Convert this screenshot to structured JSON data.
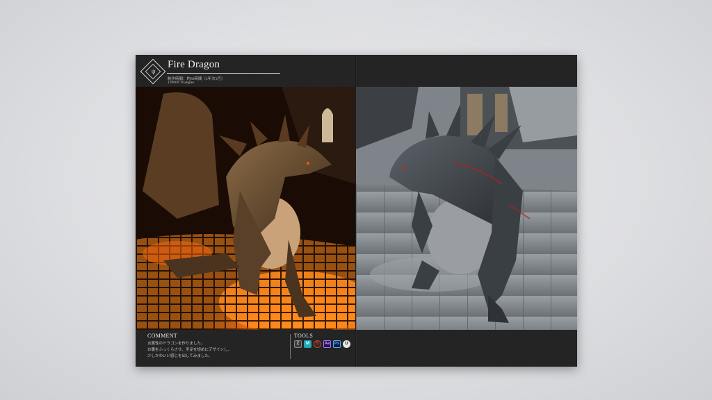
{
  "header": {
    "title": "Fire Dragon",
    "logo_glyph": "ψ",
    "meta_line_1": "制作時間：約80時間（2年次3月）",
    "meta_line_2": "139000 Triangles"
  },
  "images": {
    "left": {
      "icon": "fire-dragon-render"
    },
    "right": {
      "icon": "stone-dragon-render"
    }
  },
  "comment": {
    "title": "COMMENT",
    "lines": [
      "炎属性のドラゴンを作りました。",
      "お腹をふっくらさせ、手足を短めにデザインし、",
      "少しかわいい感じを出してみました。"
    ]
  },
  "tools": {
    "title": "TOOLS",
    "items": [
      {
        "icon": "zbrush-icon",
        "glyph": "Z"
      },
      {
        "icon": "maya-icon",
        "glyph": "M"
      },
      {
        "icon": "substance-painter-icon",
        "glyph": "S"
      },
      {
        "icon": "after-effects-icon",
        "glyph": "Ae"
      },
      {
        "icon": "photoshop-icon",
        "glyph": "Ps"
      },
      {
        "icon": "unreal-engine-icon",
        "glyph": "U"
      }
    ]
  },
  "colors": {
    "background": "#dcdde0",
    "spread": "#232323",
    "lava": "#ff7a12"
  }
}
